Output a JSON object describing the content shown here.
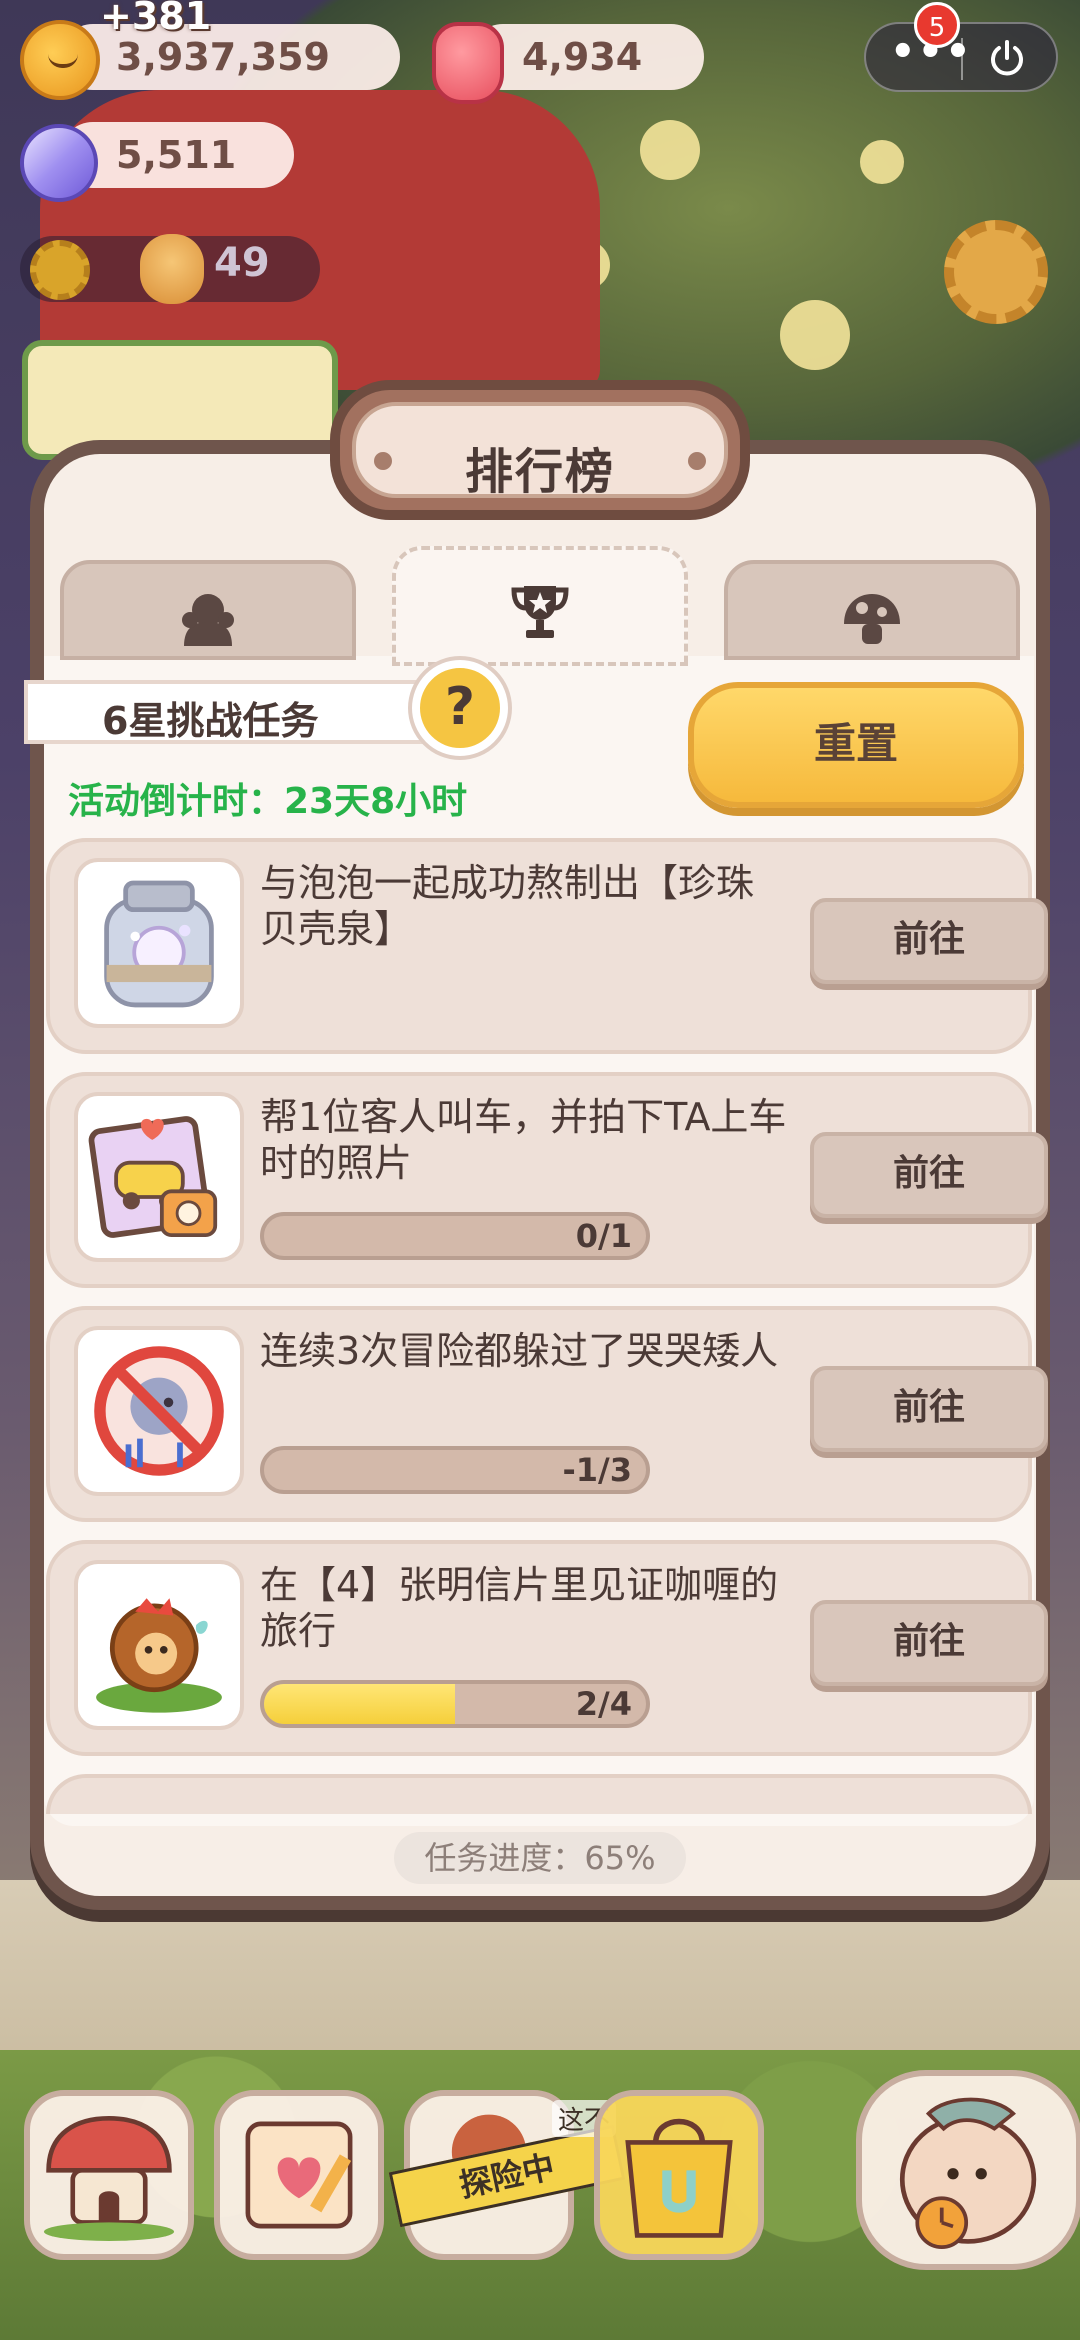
{
  "hud": {
    "plus_amount": "+381",
    "cookies": "3,937,359",
    "jelly": "4,934",
    "gems": "5,511",
    "helpers": "49",
    "notification_count": "5"
  },
  "modal": {
    "title": "排行榜",
    "tabs": [
      {
        "icon": "helpers-icon",
        "active": false
      },
      {
        "icon": "trophy-icon",
        "active": true
      },
      {
        "icon": "mushroom-icon",
        "active": false
      }
    ],
    "challenge_title": "6星挑战任务",
    "help_symbol": "?",
    "reset_label": "重置",
    "countdown": "活动倒计时：23天8小时",
    "tasks": [
      {
        "desc": "与泡泡一起成功熬制出【珍珠贝壳泉】",
        "button": "前往",
        "icon": "pearl-jar-icon"
      },
      {
        "desc": "帮1位客人叫车，并拍下TA上车时的照片",
        "button": "前往",
        "icon": "taxi-photo-icon",
        "progress_text": "0/1",
        "progress": 0
      },
      {
        "desc": "连续3次冒险都躲过了哭哭矮人",
        "button": "前往",
        "icon": "no-crying-dwarf-icon",
        "progress_text": "-1/3",
        "progress": 0
      },
      {
        "desc": "在【4】张明信片里见证咖喱的旅行",
        "button": "前往",
        "icon": "curry-cookie-icon",
        "progress_text": "2/4",
        "progress": 0.5
      }
    ],
    "overall_progress": "任务进度：65%"
  },
  "bottom": {
    "adventure_label": "探险中",
    "hint_text": "这不"
  },
  "colors": {
    "accent_yellow": "#f6b93c",
    "countdown_green": "#27b34a",
    "frame_brown": "#6f554c"
  }
}
